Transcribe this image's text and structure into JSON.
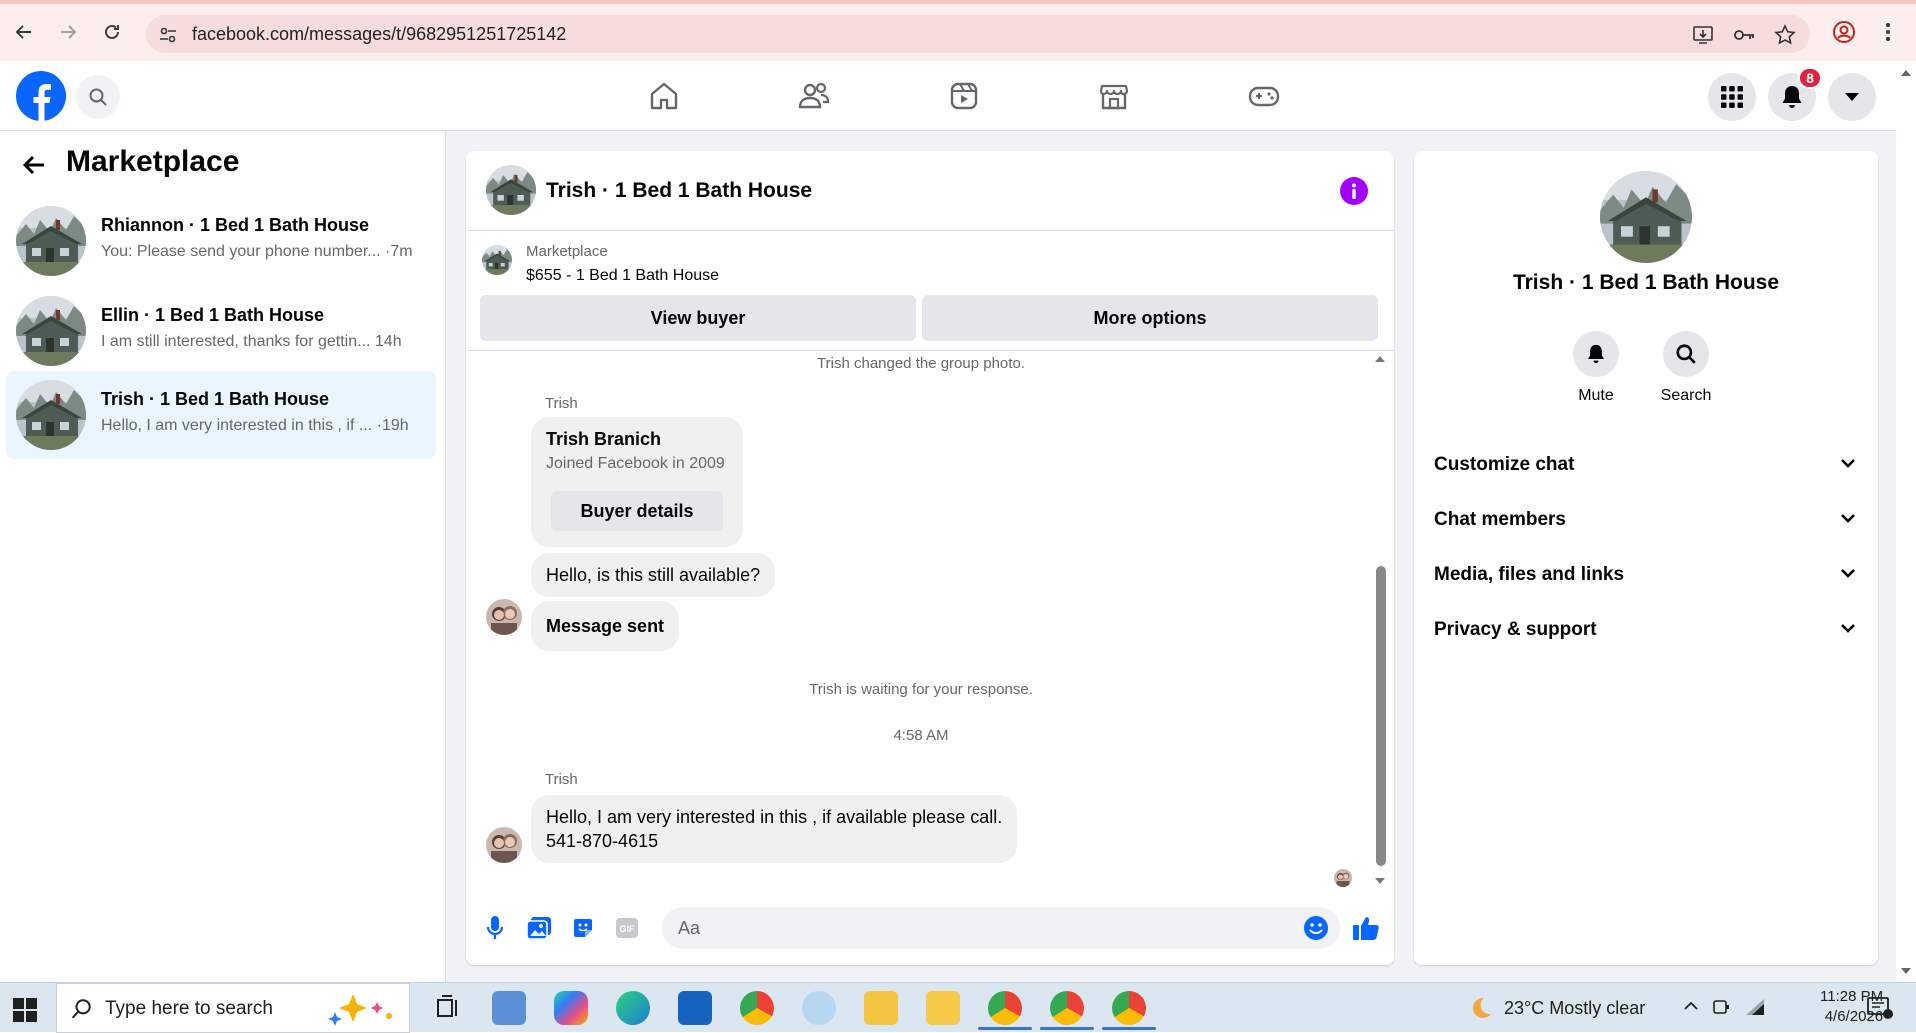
{
  "browser": {
    "url": "facebook.com/messages/t/9682951251725142"
  },
  "fb_nav": {
    "notification_count": "8"
  },
  "sidebar": {
    "title": "Marketplace",
    "conversations": [
      {
        "name": "Rhiannon · 1 Bed 1 Bath House",
        "preview": "You: Please send your phone number... ·7m",
        "active": false
      },
      {
        "name": "Ellin · 1 Bed 1 Bath House",
        "preview": "I am still interested, thanks for gettin... 14h",
        "active": false
      },
      {
        "name": "Trish · 1 Bed 1 Bath House",
        "preview": "Hello, I am very interested in this , if ... ·19h",
        "active": true
      }
    ]
  },
  "chat": {
    "title": "Trish · 1 Bed 1 Bath House",
    "listing": {
      "label": "Marketplace",
      "price_title": "$655 - 1 Bed 1 Bath House",
      "view_buyer": "View buyer",
      "more_options": "More options"
    },
    "messages": {
      "group_photo_notice": "Trish changed the group photo.",
      "sender1": "Trish",
      "card_name": "Trish Branich",
      "card_joined": "Joined Facebook in 2009",
      "card_button": "Buyer details",
      "msg_available": "Hello, is this still available?",
      "msg_sent": "Message sent",
      "waiting_notice": "Trish is waiting for your response.",
      "timestamp": "4:58 AM",
      "sender2": "Trish",
      "msg_interested_line1": "Hello, I am very interested in this , if available please call.",
      "msg_interested_line2": "541-870-4615"
    },
    "composer": {
      "placeholder": "Aa"
    }
  },
  "details_panel": {
    "name": "Trish · 1 Bed 1 Bath House",
    "actions": {
      "mute": "Mute",
      "search": "Search"
    },
    "sections": [
      "Customize chat",
      "Chat members",
      "Media, files and links",
      "Privacy & support"
    ]
  },
  "taskbar": {
    "search_placeholder": "Type here to search",
    "weather": "23°C  Mostly clear",
    "time": "11:28 PM",
    "date": "4/6/2026"
  },
  "colors": {
    "facebook_blue": "#0866ff",
    "info_purple": "#a200ff",
    "notification_red": "#e41e3f",
    "active_conversation_bg": "#ebf5ff"
  }
}
